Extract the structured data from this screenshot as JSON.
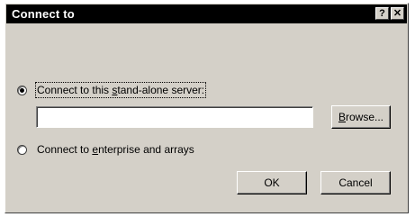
{
  "window": {
    "title": "Connect to",
    "help_glyph": "?",
    "close_glyph": "✕"
  },
  "options": {
    "standalone": {
      "pre": "Connect to this ",
      "mnemonic": "s",
      "post": "tand-alone server:",
      "checked": true
    },
    "enterprise": {
      "pre": "Connect to ",
      "mnemonic": "e",
      "post": "nterprise and arrays",
      "checked": false
    }
  },
  "server_input": {
    "value": ""
  },
  "buttons": {
    "browse": {
      "mnemonic": "B",
      "rest": "rowse..."
    },
    "ok": "OK",
    "cancel": "Cancel"
  }
}
